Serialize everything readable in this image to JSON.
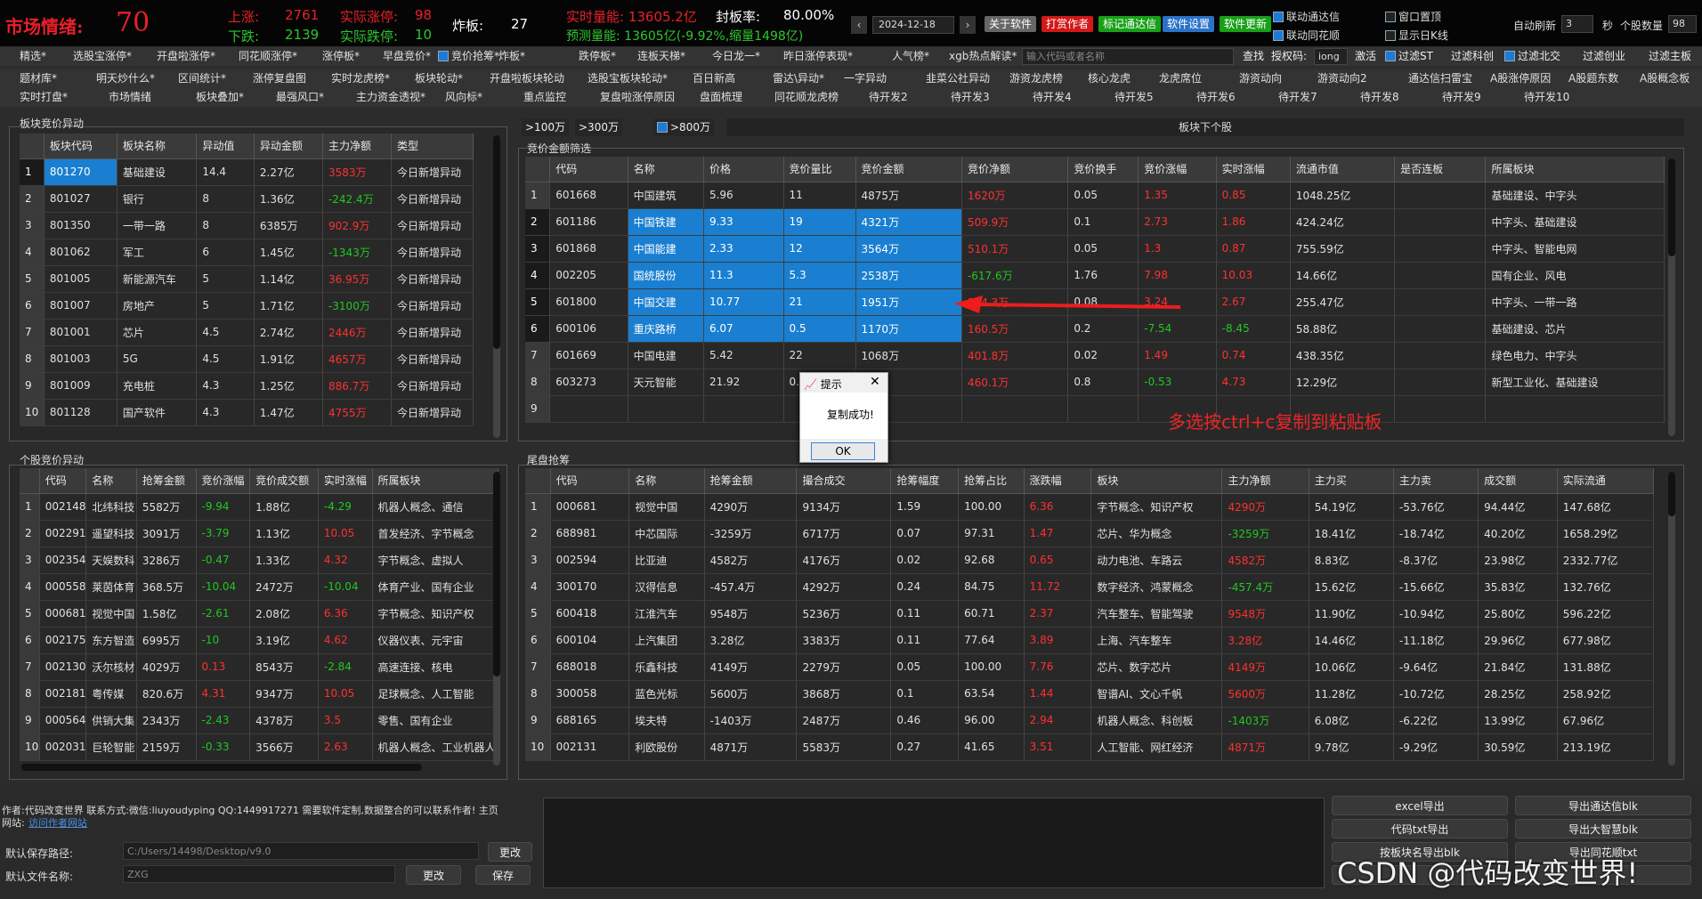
{
  "header": {
    "mood_label": "市场情绪:",
    "mood_value": "70",
    "up_label": "上涨:",
    "up_value": "2761",
    "actual_up_label": "实际涨停:",
    "actual_up_value": "98",
    "down_label": "下跌:",
    "down_value": "2139",
    "actual_down_label": "实际跌停:",
    "actual_down_value": "10",
    "broken_label": "炸板:",
    "broken_value": "27",
    "realtime_volume": "实时量能: 13605.2亿",
    "seal_rate_label": "封板率:",
    "seal_rate_value": "80.00%",
    "forecast_volume": "预测量能: 13605亿(-9.92%,缩量1498亿)",
    "date": "2024-12-18",
    "buttons": [
      "关于软件",
      "打赏作者",
      "标记通达信",
      "软件设置",
      "软件更新"
    ],
    "chk_link_tdx": "联动通达信",
    "chk_link_ths": "联动同花顺",
    "window_top": "窗口置顶",
    "show_daily": "显示日K线",
    "auto_refresh_label": "自动刷新",
    "auto_refresh_value": "3",
    "sec_label": "秒",
    "stock_count_label": "个股数量",
    "stock_count_value": "98"
  },
  "nav1": [
    "精选*",
    "选股宝涨停*",
    "开盘啦涨停*",
    "同花顺涨停*",
    "涨停板*",
    "早盘竞价*",
    "竞价抢筹*",
    "炸板*",
    "跌停板*",
    "连板天梯*",
    "今日龙一*",
    "昨日涨停表现*",
    "人气榜*",
    "xgb热点解读*"
  ],
  "search": {
    "placeholder": "输入代码或者名称",
    "btn": "查找",
    "auth_label": "授权码:",
    "auth_value": "iong",
    "activate": "激活",
    "f1": "过滤ST",
    "f2": "过滤科创",
    "f3": "过滤北交",
    "f4": "过滤创业",
    "f5": "过滤主板"
  },
  "nav2": [
    "题材库*",
    "明天炒什么*",
    "区间统计*",
    "涨停复盘图",
    "实时龙虎榜*",
    "板块轮动*",
    "开盘啦板块轮动",
    "选股宝板块轮动*",
    "百日新高",
    "雷达\\异动*",
    "一字异动",
    "韭菜公社异动",
    "游资龙虎榜",
    "核心龙虎",
    "龙虎席位",
    "游资动向",
    "游资动向2",
    "通达信扫雷宝",
    "A股涨停原因",
    "A股题东数",
    "A股概念板"
  ],
  "nav3": [
    "实时打盘*",
    "市场情绪",
    "板块叠加*",
    "最强风口*",
    "主力资金透视*",
    "风向标*",
    "重点监控",
    "复盘啦涨停原因",
    "盘面梳理",
    "同花顺龙虎榜",
    "待开发2",
    "待开发3",
    "待开发4",
    "待开发5",
    "待开发6",
    "待开发7",
    "待开发8",
    "待开发9",
    "待开发10"
  ],
  "sector_panel": {
    "title": "板块竞价异动",
    "headers": [
      "",
      "板块代码",
      "板块名称",
      "异动值",
      "异动金额",
      "主力净额",
      "类型"
    ],
    "rows": [
      [
        "1",
        "801270",
        "基础建设",
        "14.4",
        "2.27亿",
        "3583万",
        "今日新增异动"
      ],
      [
        "2",
        "801027",
        "银行",
        "8",
        "1.36亿",
        "-242.4万",
        "今日新增异动"
      ],
      [
        "3",
        "801350",
        "一带一路",
        "8",
        "6385万",
        "902.9万",
        "今日新增异动"
      ],
      [
        "4",
        "801062",
        "军工",
        "6",
        "1.45亿",
        "-1343万",
        "今日新增异动"
      ],
      [
        "5",
        "801005",
        "新能源汽车",
        "5",
        "1.14亿",
        "36.95万",
        "今日新增异动"
      ],
      [
        "6",
        "801007",
        "房地产",
        "5",
        "1.71亿",
        "-3100万",
        "今日新增异动"
      ],
      [
        "7",
        "801001",
        "芯片",
        "4.5",
        "2.74亿",
        "2446万",
        "今日新增异动"
      ],
      [
        "8",
        "801003",
        "5G",
        "4.5",
        "1.91亿",
        "4657万",
        "今日新增异动"
      ],
      [
        "9",
        "801009",
        "充电桩",
        "4.3",
        "1.25亿",
        "886.7万",
        "今日新增异动"
      ],
      [
        "10",
        "801128",
        "国产软件",
        "4.3",
        "1.47亿",
        "4755万",
        "今日新增异动"
      ]
    ]
  },
  "amount_filter": {
    "f1": ">100万",
    "f2": ">300万",
    "f3": ">800万",
    "next_btn": "板块下个股",
    "title": "竞价金额筛选",
    "headers": [
      "",
      "代码",
      "名称",
      "价格",
      "竞价量比",
      "竞价金额",
      "竞价净额",
      "竞价换手",
      "竞价涨幅",
      "实时涨幅",
      "流通市值",
      "是否连板",
      "所属板块"
    ],
    "rows": [
      [
        "1",
        "601668",
        "中国建筑",
        "5.96",
        "11",
        "4875万",
        "1620万",
        "0.05",
        "1.35",
        "0.85",
        "1048.25亿",
        "",
        "基础建设、中字头"
      ],
      [
        "2",
        "601186",
        "中国铁建",
        "9.33",
        "19",
        "4321万",
        "509.9万",
        "0.1",
        "2.73",
        "1.86",
        "424.24亿",
        "",
        "中字头、基础建设"
      ],
      [
        "3",
        "601868",
        "中国能建",
        "2.33",
        "12",
        "3564万",
        "510.1万",
        "0.05",
        "1.3",
        "0.87",
        "755.59亿",
        "",
        "中字头、智能电网"
      ],
      [
        "4",
        "002205",
        "国统股份",
        "11.3",
        "5.3",
        "2538万",
        "-617.6万",
        "1.76",
        "7.98",
        "10.03",
        "14.66亿",
        "",
        "国有企业、风电"
      ],
      [
        "5",
        "601800",
        "中国交建",
        "10.77",
        "21",
        "1951万",
        "334.3万",
        "0.08",
        "3.24",
        "2.67",
        "255.47亿",
        "",
        "中字头、一带一路"
      ],
      [
        "6",
        "600106",
        "重庆路桥",
        "6.07",
        "0.5",
        "1170万",
        "160.5万",
        "0.2",
        "-7.54",
        "-8.45",
        "58.88亿",
        "",
        "基础建设、芯片"
      ],
      [
        "7",
        "601669",
        "中国电建",
        "5.42",
        "22",
        "1068万",
        "401.8万",
        "0.02",
        "1.49",
        "0.74",
        "438.35亿",
        "",
        "绿色电力、中字头"
      ],
      [
        "8",
        "603273",
        "天元智能",
        "21.92",
        "0.5",
        "",
        "460.1万",
        "0.8",
        "-0.53",
        "4.73",
        "12.29亿",
        "",
        "新型工业化、基础建设"
      ],
      [
        "9",
        "",
        "",
        "",
        "",
        "",
        "",
        "",
        "",
        "",
        "",
        "",
        ""
      ]
    ]
  },
  "annotation": "多选按ctrl+c复制到粘贴板",
  "dialog": {
    "title": "提示",
    "message": "复制成功!",
    "ok": "OK"
  },
  "stock_panel": {
    "title": "个股竞价异动",
    "headers": [
      "",
      "代码",
      "名称",
      "抢筹金额",
      "竞价涨幅",
      "竞价成交额",
      "实时涨幅",
      "所属板块"
    ],
    "rows": [
      [
        "1",
        "002148",
        "北纬科技",
        "5582万",
        "-9.94",
        "1.88亿",
        "-4.29",
        "机器人概念、通信"
      ],
      [
        "2",
        "002291",
        "遥望科技",
        "3091万",
        "-3.79",
        "1.13亿",
        "10.05",
        "首发经济、字节概念"
      ],
      [
        "3",
        "002354",
        "天娱数科",
        "3286万",
        "-0.47",
        "1.33亿",
        "4.32",
        "字节概念、虚拟人"
      ],
      [
        "4",
        "000558",
        "莱茵体育",
        "368.5万",
        "-10.04",
        "2472万",
        "-10.04",
        "体育产业、国有企业"
      ],
      [
        "5",
        "000681",
        "视觉中国",
        "1.58亿",
        "-2.61",
        "2.08亿",
        "6.36",
        "字节概念、知识产权"
      ],
      [
        "6",
        "002175",
        "东方智造",
        "6995万",
        "-10",
        "3.19亿",
        "4.62",
        "仪器仪表、元宇宙"
      ],
      [
        "7",
        "002130",
        "沃尔核材",
        "4029万",
        "0.13",
        "8543万",
        "-2.84",
        "高速连接、核电"
      ],
      [
        "8",
        "002181",
        "粤传媒",
        "820.6万",
        "4.31",
        "9347万",
        "10.05",
        "足球概念、人工智能"
      ],
      [
        "9",
        "000564",
        "供销大集",
        "2343万",
        "-2.43",
        "4378万",
        "3.5",
        "零售、国有企业"
      ],
      [
        "10",
        "002031",
        "巨轮智能",
        "2159万",
        "-0.33",
        "3566万",
        "2.63",
        "机器人概念、工业机器人"
      ]
    ]
  },
  "tail_panel": {
    "title": "尾盘抢筹",
    "headers": [
      "",
      "代码",
      "名称",
      "抢筹金额",
      "撮合成交",
      "抢筹幅度",
      "抢筹占比",
      "涨跌幅",
      "板块",
      "主力净额",
      "主力买",
      "主力卖",
      "成交额",
      "实际流通"
    ],
    "rows": [
      [
        "1",
        "000681",
        "视觉中国",
        "4290万",
        "9134万",
        "1.59",
        "100.00",
        "6.36",
        "字节概念、知识产权",
        "4290万",
        "54.19亿",
        "-53.76亿",
        "94.44亿",
        "147.68亿"
      ],
      [
        "2",
        "688981",
        "中芯国际",
        "-3259万",
        "6717万",
        "0.07",
        "97.31",
        "1.47",
        "芯片、华为概念",
        "-3259万",
        "18.41亿",
        "-18.74亿",
        "40.20亿",
        "1658.29亿"
      ],
      [
        "3",
        "002594",
        "比亚迪",
        "4582万",
        "4176万",
        "0.02",
        "92.68",
        "0.65",
        "动力电池、车路云",
        "4582万",
        "8.83亿",
        "-8.37亿",
        "23.98亿",
        "2332.77亿"
      ],
      [
        "4",
        "300170",
        "汉得信息",
        "-457.4万",
        "4292万",
        "0.24",
        "84.75",
        "11.72",
        "数字经济、鸿蒙概念",
        "-457.4万",
        "15.62亿",
        "-15.66亿",
        "35.83亿",
        "132.76亿"
      ],
      [
        "5",
        "600418",
        "江淮汽车",
        "9548万",
        "5236万",
        "0.11",
        "60.71",
        "2.37",
        "汽车整车、智能驾驶",
        "9548万",
        "11.90亿",
        "-10.94亿",
        "25.80亿",
        "596.22亿"
      ],
      [
        "6",
        "600104",
        "上汽集团",
        "3.28亿",
        "3383万",
        "0.11",
        "77.64",
        "3.89",
        "上海、汽车整车",
        "3.28亿",
        "14.46亿",
        "-11.18亿",
        "29.96亿",
        "677.98亿"
      ],
      [
        "7",
        "688018",
        "乐鑫科技",
        "4149万",
        "2279万",
        "0.05",
        "100.00",
        "7.76",
        "芯片、数字芯片",
        "4149万",
        "10.06亿",
        "-9.64亿",
        "21.84亿",
        "131.88亿"
      ],
      [
        "8",
        "300058",
        "蓝色光标",
        "5600万",
        "3868万",
        "0.1",
        "63.54",
        "1.44",
        "智谱AI、文心千帆",
        "5600万",
        "11.28亿",
        "-10.72亿",
        "28.25亿",
        "258.92亿"
      ],
      [
        "9",
        "688165",
        "埃夫特",
        "-1403万",
        "2487万",
        "0.46",
        "96.00",
        "2.94",
        "机器人概念、科创板",
        "-1403万",
        "6.08亿",
        "-6.22亿",
        "13.99亿",
        "67.96亿"
      ],
      [
        "10",
        "002131",
        "利欧股份",
        "4871万",
        "5583万",
        "0.27",
        "41.65",
        "3.51",
        "人工智能、网红经济",
        "4871万",
        "9.78亿",
        "-9.29亿",
        "30.59亿",
        "213.19亿"
      ]
    ]
  },
  "footer": {
    "author_line": "作者:代码改变世界 联系方式:微信:liuyoudyping QQ:1449917271 需要软件定制,数据整合的可以联系作者! 主页",
    "site_label": "网站:",
    "site_link": "访问作者网站",
    "save_path_label": "默认保存路径:",
    "save_path_value": "C:/Users/14498/Desktop/v9.0",
    "change1": "更改",
    "file_name_label": "默认文件名称:",
    "file_name_value": "ZXG",
    "change2": "更改",
    "save": "保存",
    "buttons": [
      "excel导出",
      "导出通达信blk",
      "代码txt导出",
      "导出大智慧blk",
      "按板块名导出blk",
      "导出同花顺txt",
      "",
      ""
    ],
    "watermark": "CSDN @代码改变世界!"
  }
}
